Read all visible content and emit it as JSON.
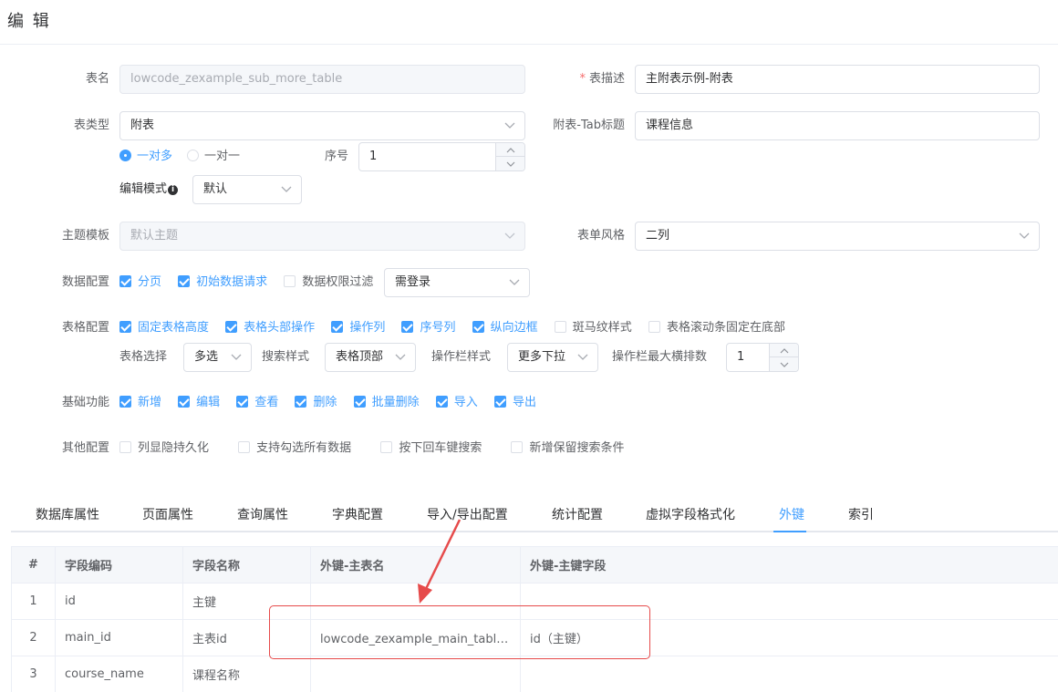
{
  "header": {
    "title": "编 辑"
  },
  "form": {
    "table_name": {
      "label": "表名",
      "value": "lowcode_zexample_sub_more_table"
    },
    "table_desc": {
      "required": "*",
      "label": "表描述",
      "value": "主附表示例-附表"
    },
    "table_type": {
      "label": "表类型",
      "value": "附表"
    },
    "tab_title": {
      "label": "附表-Tab标题",
      "value": "课程信息"
    },
    "relation": {
      "one_to_many": "一对多",
      "one_to_one": "一对一",
      "selected": "一对多"
    },
    "order": {
      "label": "序号",
      "value": "1"
    },
    "edit_mode": {
      "label": "编辑模式",
      "value": "默认"
    },
    "theme": {
      "label": "主题模板",
      "value": "默认主题"
    },
    "form_style": {
      "label": "表单风格",
      "value": "二列"
    },
    "data_config": {
      "label": "数据配置",
      "items": [
        {
          "text": "分页",
          "checked": true
        },
        {
          "text": "初始数据请求",
          "checked": true
        },
        {
          "text": "数据权限过滤",
          "checked": false
        }
      ],
      "auth_select": "需登录"
    },
    "grid_config": {
      "label": "表格配置",
      "items": [
        {
          "text": "固定表格高度",
          "checked": true
        },
        {
          "text": "表格头部操作",
          "checked": true
        },
        {
          "text": "操作列",
          "checked": true
        },
        {
          "text": "序号列",
          "checked": true
        },
        {
          "text": "纵向边框",
          "checked": true
        },
        {
          "text": "斑马纹样式",
          "checked": false
        },
        {
          "text": "表格滚动条固定在底部",
          "checked": false
        }
      ],
      "select_label": "表格选择",
      "select_value": "多选",
      "search_label": "搜索样式",
      "search_value": "表格顶部",
      "op_label": "操作栏样式",
      "op_value": "更多下拉",
      "max_label": "操作栏最大横排数",
      "max_value": "1"
    },
    "basic": {
      "label": "基础功能",
      "items": [
        {
          "text": "新增",
          "checked": true
        },
        {
          "text": "编辑",
          "checked": true
        },
        {
          "text": "查看",
          "checked": true
        },
        {
          "text": "删除",
          "checked": true
        },
        {
          "text": "批量删除",
          "checked": true
        },
        {
          "text": "导入",
          "checked": true
        },
        {
          "text": "导出",
          "checked": true
        }
      ]
    },
    "other": {
      "label": "其他配置",
      "items": [
        {
          "text": "列显隐持久化",
          "checked": false
        },
        {
          "text": "支持勾选所有数据",
          "checked": false
        },
        {
          "text": "按下回车键搜索",
          "checked": false
        },
        {
          "text": "新增保留搜索条件",
          "checked": false
        }
      ]
    }
  },
  "tabs": [
    "数据库属性",
    "页面属性",
    "查询属性",
    "字典配置",
    "导入/导出配置",
    "统计配置",
    "虚拟字段格式化",
    "外键",
    "索引"
  ],
  "active_tab": "外键",
  "table": {
    "headers": [
      "#",
      "字段编码",
      "字段名称",
      "外键-主表名",
      "外键-主键字段"
    ],
    "rows": [
      [
        "1",
        "id",
        "主键",
        "",
        ""
      ],
      [
        "2",
        "main_id",
        "主表id",
        "lowcode_zexample_main_table（...",
        "id（主键）"
      ],
      [
        "3",
        "course_name",
        "课程名称",
        "",
        ""
      ]
    ]
  },
  "colors": {
    "primary": "#409eff",
    "annotation": "#e64b4b"
  }
}
